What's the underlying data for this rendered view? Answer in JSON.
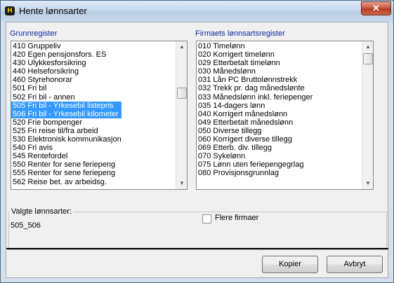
{
  "window": {
    "title": "Hente lønnsarter",
    "close_glyph": "✕",
    "app_icon_glyph": "H"
  },
  "left": {
    "label": "Grunnregister",
    "items": [
      "410 Gruppeliv",
      "420 Egen pensjonsfors. ES",
      "430 Ulykkesforsikring",
      "440 Helseforsikring",
      "460 Styrehonorar",
      "501 Fri bil",
      "502 Fri bil - annen",
      "505 Fri bil - Yrkesebil listepris",
      "506 Fri bil - Yrkesebil kilometer",
      "520 Frie bompenger",
      "525 Fri reise til/fra arbeid",
      "530 Elektronisk kommunikasjon",
      "540 Fri avis",
      "545 Rentefordel",
      "550 Renter for sene feriepeng",
      "555 Renter for sene feriepeng",
      "562 Reise bet. av arbeidsg."
    ],
    "selected": [
      "505 Fri bil - Yrkesebil listepris",
      "506 Fri bil - Yrkesebil kilometer"
    ]
  },
  "right": {
    "label": "Firmaets lønnsartsregister",
    "items": [
      "010 Timelønn",
      "020 Korrigert timelønn",
      "029 Etterbetalt timelønn",
      "030 Månedslønn",
      "031 Lån PC Bruttolønnstrekk",
      "032 Trekk pr. dag månedslønte",
      "033 Månedslønn inkl. feriepenger",
      "035 14-dagers lønn",
      "040 Korrigert månedslønn",
      "049 Etterbetalt månedslønn",
      "050 Diverse tillegg",
      "060 Korrigert diverse tillegg",
      "069 Etterb. div. tillegg",
      "070 Sykelønn",
      "075 Lønn uten feriepengegrlag",
      "080 Provisjonsgrunnlag"
    ]
  },
  "valgte": {
    "label": "Valgte lønnsarter:",
    "value": "505_506"
  },
  "flere_firmaer": {
    "label": "Flere firmaer",
    "checked": false
  },
  "buttons": {
    "kopier": "Kopier",
    "avbryt": "Avbryt"
  },
  "colors": {
    "selection": "#3399ff",
    "group_label": "#0b2a9e"
  }
}
